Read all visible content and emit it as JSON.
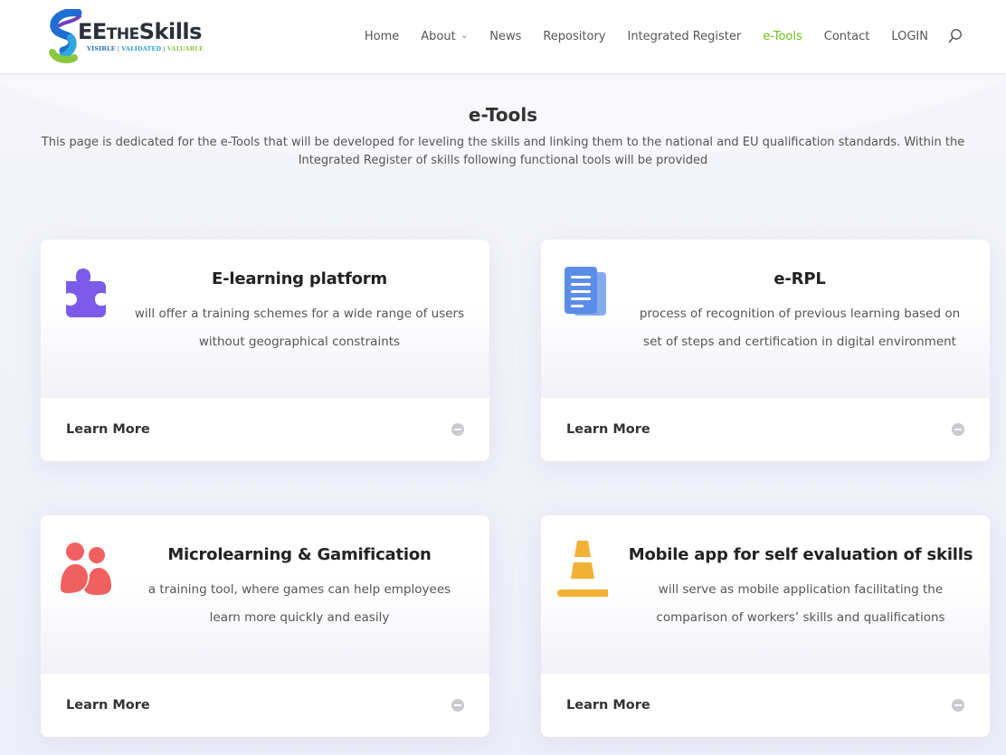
{
  "header": {
    "logo": {
      "word_prefix": "EE",
      "word_small": "the",
      "word_suffix": "Skills",
      "tag_visible": "VISIBLE",
      "tag_separator": "|",
      "tag_validated": "VALIDATED",
      "tag_valuable": "VALUABLE"
    },
    "nav": [
      {
        "label": "Home",
        "active": false
      },
      {
        "label": "About",
        "active": false,
        "has_dropdown": true
      },
      {
        "label": "News",
        "active": false
      },
      {
        "label": "Repository",
        "active": false
      },
      {
        "label": "Integrated Register",
        "active": false
      },
      {
        "label": "e-Tools",
        "active": true
      },
      {
        "label": "Contact",
        "active": false
      },
      {
        "label": "LOGIN",
        "active": false
      }
    ],
    "search_icon": "search-icon"
  },
  "intro": {
    "title": "e-Tools",
    "text": "This page is dedicated for the e-Tools that will be developed for leveling the skills and linking them to the national and EU qualification standards. Within the Integrated Register of skills following functional tools will be provided"
  },
  "cards": [
    {
      "icon": "puzzle-piece-icon",
      "icon_color": "#7b5be8",
      "title": "E-learning platform",
      "description": "will offer a training schemes for a wide range of users without geographical constraints",
      "link_label": "Learn More"
    },
    {
      "icon": "document-icon",
      "icon_color": "#5b8de6",
      "title": "e-RPL",
      "description": "process of recognition of previous learning based on set of steps and certification in digital environment",
      "link_label": "Learn More"
    },
    {
      "icon": "users-icon",
      "icon_color": "#f0605f",
      "title": "Microlearning & Gamification",
      "description": "a training tool, where games can help employees learn more quickly and easily",
      "link_label": "Learn More"
    },
    {
      "icon": "traffic-cone-icon",
      "icon_color": "#f2b134",
      "title": "Mobile app for self evaluation of skills",
      "description": "will serve as mobile application facilitating the comparison of workers’ skills and qualifications",
      "link_label": "Learn More"
    }
  ],
  "colors": {
    "accent_active_nav": "#6cbf1a",
    "page_background": "#f0f0f8",
    "card_background": "#ffffff",
    "toggle_grey": "#c9c9ce"
  }
}
